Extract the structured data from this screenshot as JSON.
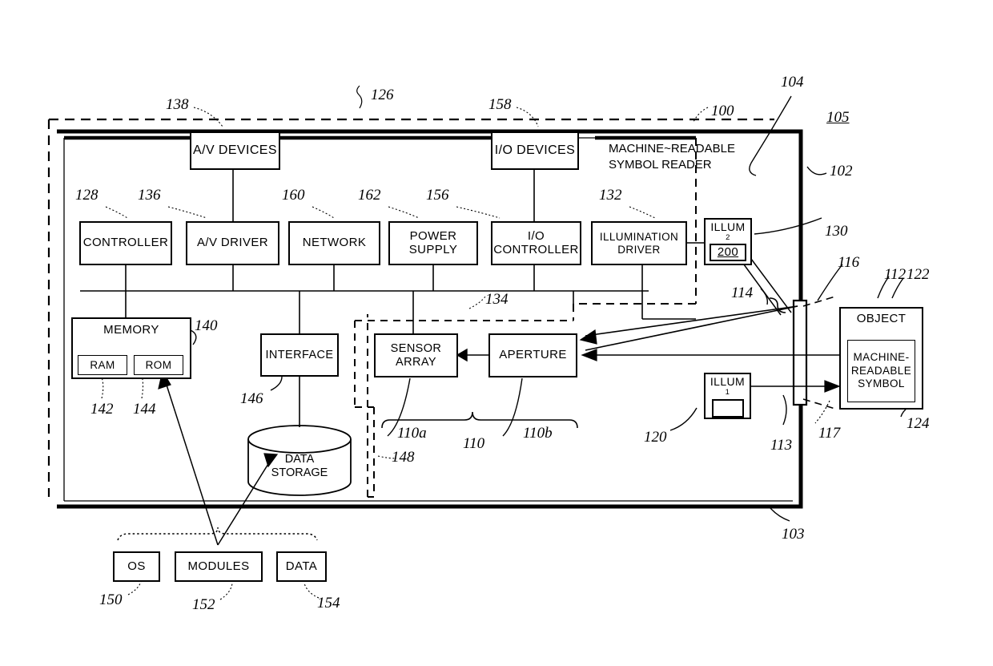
{
  "figure": {
    "title_label": "105",
    "device_label": "MACHINE~READABLE SYMBOL READER",
    "device_line1": "MACHINE~READABLE",
    "device_line2": "SYMBOL READER"
  },
  "blocks": {
    "av_devices": {
      "label": "A/V DEVICES",
      "ref": "138"
    },
    "io_devices": {
      "label": "I/O DEVICES",
      "ref": "158"
    },
    "controller": {
      "label": "CONTROLLER",
      "ref": "128"
    },
    "av_driver": {
      "label": "A/V DRIVER",
      "ref": "136"
    },
    "network": {
      "label": "NETWORK",
      "ref": "160"
    },
    "power_supply": {
      "label_line1": "POWER",
      "label_line2": "SUPPLY",
      "ref": "162"
    },
    "io_controller": {
      "label_line1": "I/O",
      "label_line2": "CONTROLLER",
      "ref": "156"
    },
    "illumination_driver": {
      "label_line1": "ILLUMINATION",
      "label_line2": "DRIVER",
      "ref": "132"
    },
    "illum2": {
      "label": "ILLUM",
      "subscript": "2",
      "inner_value": "200",
      "ref": "130"
    },
    "illum1": {
      "label": "ILLUM",
      "subscript": "1",
      "ref": "120"
    },
    "memory": {
      "label": "MEMORY",
      "ref": "140",
      "ram": "RAM",
      "ram_ref": "142",
      "rom": "ROM",
      "rom_ref": "144"
    },
    "interface": {
      "label": "INTERFACE",
      "ref": "146"
    },
    "data_storage": {
      "label_line1": "DATA",
      "label_line2": "STORAGE",
      "ref": "148"
    },
    "sensor_array": {
      "label_line1": "SENSOR",
      "label_line2": "ARRAY",
      "ref": "110a"
    },
    "aperture": {
      "label": "APERTURE",
      "ref": "110b"
    },
    "object": {
      "label": "OBJECT",
      "ref": "122"
    },
    "mrs": {
      "label_line1": "MACHINE-",
      "label_line2": "READABLE",
      "label_line3": "SYMBOL",
      "ref": "124"
    },
    "os": {
      "label": "OS",
      "ref": "150"
    },
    "modules": {
      "label": "MODULES",
      "ref": "152"
    },
    "data": {
      "label": "DATA",
      "ref": "154"
    }
  },
  "refs": {
    "system_126": "126",
    "reader_100": "100",
    "housing_104": "104",
    "wall_102": "102",
    "bottom_103": "103",
    "bus_134": "134",
    "imager_110": "110",
    "window_116": "116",
    "fov_114": "114",
    "ray_112": "112",
    "ray_113": "113",
    "ray_117": "117"
  }
}
